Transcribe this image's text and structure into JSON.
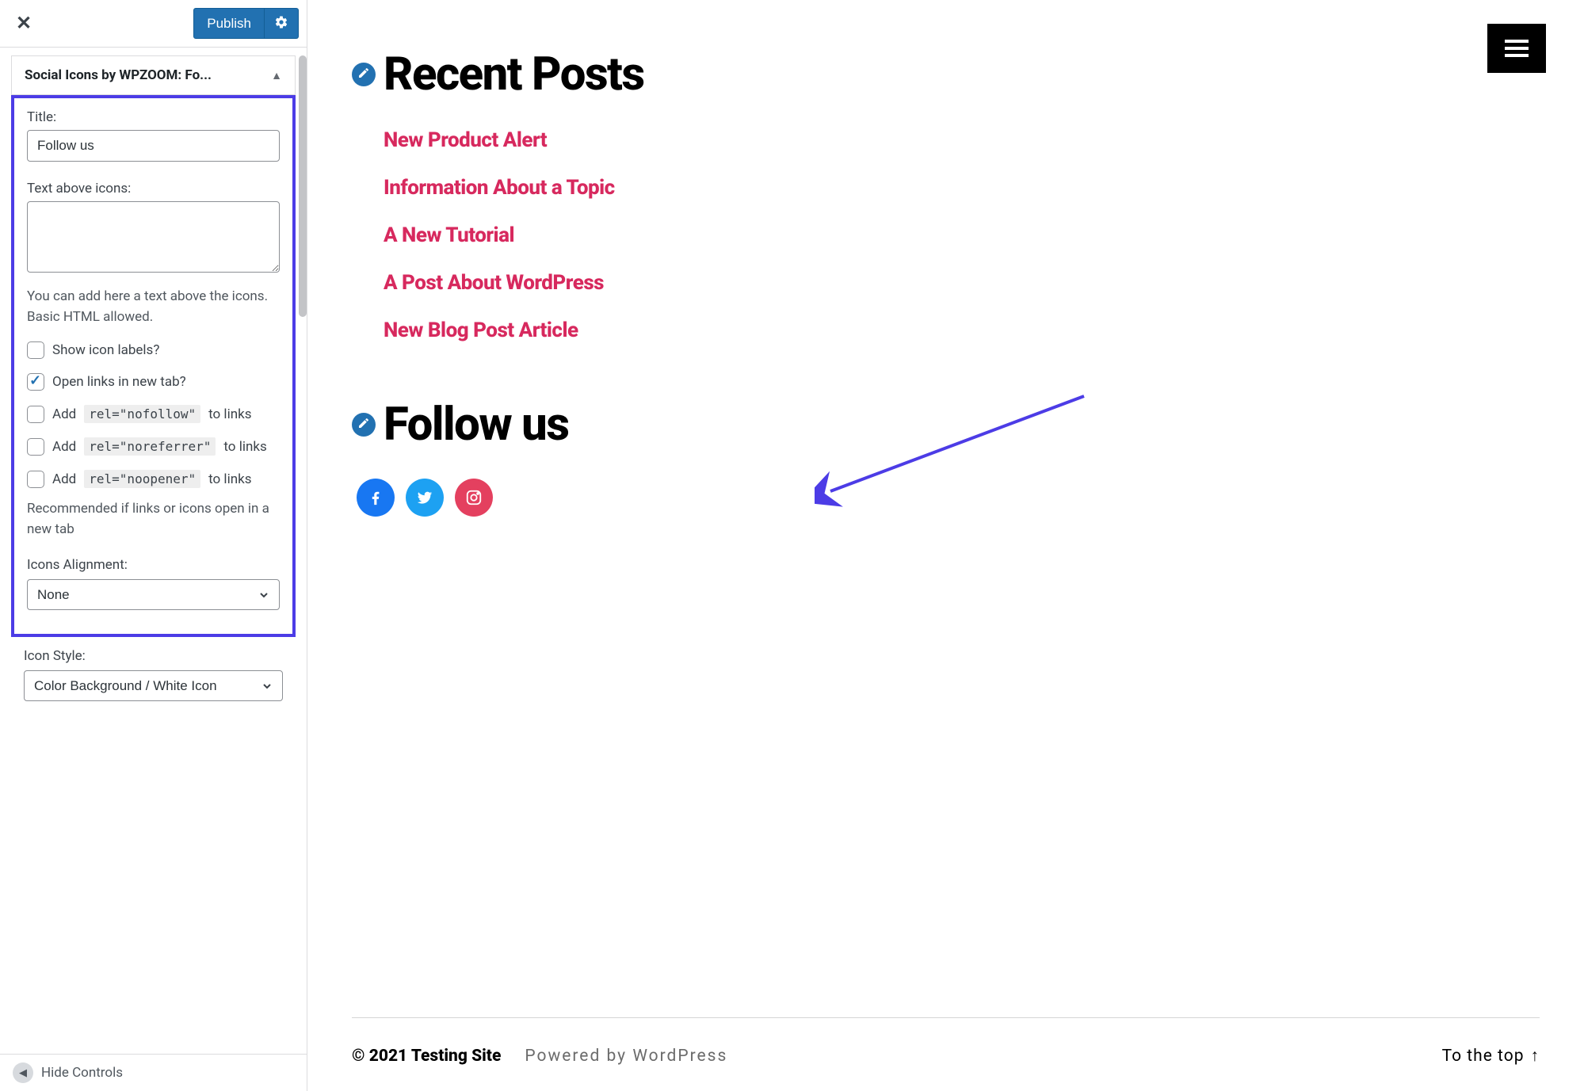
{
  "sidebar": {
    "publish_label": "Publish",
    "accordion_title": "Social Icons by WPZOOM: Fo...",
    "title_label": "Title:",
    "title_value": "Follow us",
    "text_above_label": "Text above icons:",
    "text_above_value": "",
    "help1": "You can add here a text above the icons. Basic HTML allowed.",
    "cb_show_labels": "Show icon labels?",
    "cb_new_tab": "Open links in new tab?",
    "cb_add_pre": "Add ",
    "code_nofollow": "rel=\"nofollow\"",
    "code_noreferrer": "rel=\"noreferrer\"",
    "code_noopener": "rel=\"noopener\"",
    "cb_add_post": " to links",
    "help2": "Recommended if links or icons open in a new tab",
    "alignment_label": "Icons Alignment:",
    "alignment_value": "None",
    "icon_style_label": "Icon Style:",
    "icon_style_value": "Color Background / White Icon",
    "hide_controls": "Hide Controls"
  },
  "preview": {
    "recent_heading": "Recent Posts",
    "posts": [
      "New Product Alert",
      "Information About a Topic",
      "A New Tutorial",
      "A Post About WordPress",
      "New Blog Post Article"
    ],
    "follow_heading": "Follow us",
    "social": [
      "facebook",
      "twitter",
      "instagram"
    ],
    "footer_copy": "© 2021 Testing Site",
    "footer_powered": "Powered by WordPress",
    "footer_to_top": "To the top"
  }
}
